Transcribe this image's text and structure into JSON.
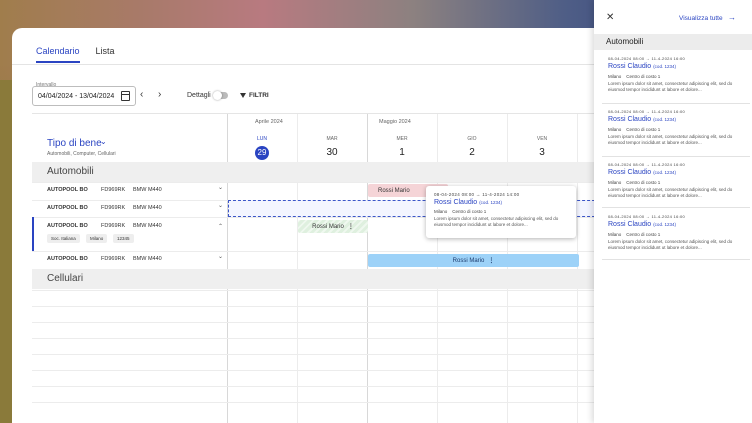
{
  "tabs": [
    {
      "label": "Calendario",
      "active": true
    },
    {
      "label": "Lista",
      "active": false
    }
  ],
  "toolbar": {
    "interval_label": "Intervallo",
    "interval_value": "04/04/2024 - 13/04/2024",
    "prev": "‹",
    "next": "›",
    "details_label": "Dettagli",
    "filter_label": "FILTRI"
  },
  "calendar": {
    "months": [
      "Aprile 2024",
      "Maggio 2024"
    ],
    "days": [
      {
        "name": "LUN",
        "num": "29"
      },
      {
        "name": "MAR",
        "num": "30"
      },
      {
        "name": "MER",
        "num": "1"
      },
      {
        "name": "GIO",
        "num": "2"
      },
      {
        "name": "VEN",
        "num": "3"
      }
    ]
  },
  "asset_type": {
    "title": "Tipo di bene",
    "subtitle": "Automobili, Computer, Cellulari"
  },
  "groups": [
    "Automobili",
    "Cellulari"
  ],
  "rows": [
    {
      "pool": "AUTOPOOL BO",
      "plate": "FD969RK",
      "model": "BMW M440",
      "chev": "⌄"
    },
    {
      "pool": "AUTOPOOL BO",
      "plate": "FD969RK",
      "model": "BMW M440",
      "chev": "⌄"
    },
    {
      "pool": "AUTOPOOL BO",
      "plate": "FD969RK",
      "model": "BMW M440",
      "chev": "⌃",
      "chips": [
        "Soc. Italiana",
        "Milano",
        "12345"
      ]
    },
    {
      "pool": "AUTOPOOL BO",
      "plate": "FD969RK",
      "model": "BMW M440",
      "chev": "⌄"
    }
  ],
  "bookings": [
    {
      "label": "Rossi Mario",
      "color": "#f5d4d7"
    },
    {
      "label": "Rossi Mario",
      "color": "#dff0df"
    },
    {
      "label": "Rossi Mario",
      "color": "#9dd2f8"
    }
  ],
  "popover": {
    "date": "08-04-2024 08:00 → 11-4-2024 14:00",
    "name": "Rossi Claudio",
    "code": "(cod. 1234)",
    "city": "Milano",
    "cost_center": "Centro di costo 1",
    "text": "Lorem ipsum dolor sit amet, consectetur adipiscing elit, sed do eiusmod tempor incididunt ut labore et dolore..."
  },
  "panel": {
    "view_all": "Visualizza tutte",
    "section": "Automobili",
    "cards": [
      {
        "date": "08-04-2024 08:00 → 11-4-2024 16:00",
        "name": "Rossi Claudio",
        "code": "(cod. 1234)",
        "city": "Milano",
        "cost_center": "Centro di costo 1",
        "text": "Lorem ipsum dolor sit amet, consectetur adipiscing elit, sed do eiusmod tempor incididunt ut labore et dolore..."
      },
      {
        "date": "08-04-2024 08:00 → 11-4-2024 16:00",
        "name": "Rossi Claudio",
        "code": "(cod. 1234)",
        "city": "Milano",
        "cost_center": "Centro di costo 1",
        "text": "Lorem ipsum dolor sit amet, consectetur adipiscing elit, sed do eiusmod tempor incididunt ut labore et dolore..."
      },
      {
        "date": "08-04-2024 08:00 → 11-4-2024 16:00",
        "name": "Rossi Claudio",
        "code": "(cod. 1234)",
        "city": "Milano",
        "cost_center": "Centro di costo 1",
        "text": "Lorem ipsum dolor sit amet, consectetur adipiscing elit, sed do eiusmod tempor incididunt ut labore et dolore..."
      },
      {
        "date": "08-04-2024 08:00 → 11-4-2024 16:00",
        "name": "Rossi Claudio",
        "code": "(cod. 1234)",
        "city": "Milano",
        "cost_center": "Centro di costo 1",
        "text": "Lorem ipsum dolor sit amet, consectetur adipiscing elit, sed do eiusmod tempor incididunt ut labore et dolore..."
      }
    ]
  }
}
